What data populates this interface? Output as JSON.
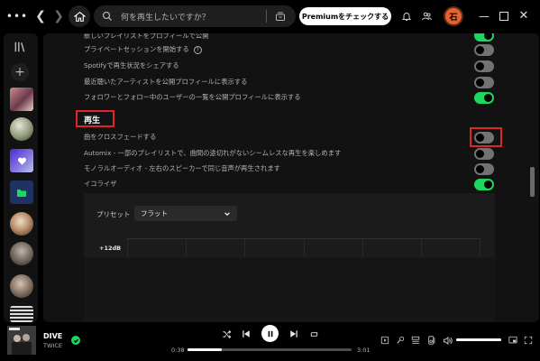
{
  "topbar": {
    "search_placeholder": "何を再生したいですか？",
    "premium_label": "Premiumをチェックする",
    "avatar_initial": "石"
  },
  "settings": {
    "rows": [
      {
        "label": "新しいプレイリストをプロフィールで公開",
        "on": true
      },
      {
        "label": "プライベートセッションを開始する",
        "on": false
      },
      {
        "label": "Spotifyで再生状況をシェアする",
        "on": false
      },
      {
        "label": "最近聴いたアーティストを公開プロフィールに表示する",
        "on": false
      },
      {
        "label": "フォロワーとフォロー中のユーザーの一覧を公開プロフィールに表示する",
        "on": true
      }
    ],
    "playback_title": "再生",
    "playback_rows": [
      {
        "label": "曲をクロスフェードする",
        "on": false
      },
      {
        "label": "Automix - 一部のプレイリストで、曲間の途切れがないシームレスな再生を楽しめます",
        "on": false
      },
      {
        "label": "モノラルオーディオ - 左右のスピーカーで同じ音声が再生されます",
        "on": false
      },
      {
        "label": "イコライザ",
        "on": true
      }
    ],
    "equalizer": {
      "preset_label": "プリセット",
      "preset_value": "フラット",
      "db_label": "+12dB"
    }
  },
  "player": {
    "title": "DIVE",
    "artist": "TWICE",
    "elapsed": "0:38",
    "duration": "3:01",
    "progress": 0.21,
    "volume": 1.0
  },
  "colors": {
    "accent": "#1ed760",
    "highlight": "#e0242a",
    "background": "#121212"
  }
}
